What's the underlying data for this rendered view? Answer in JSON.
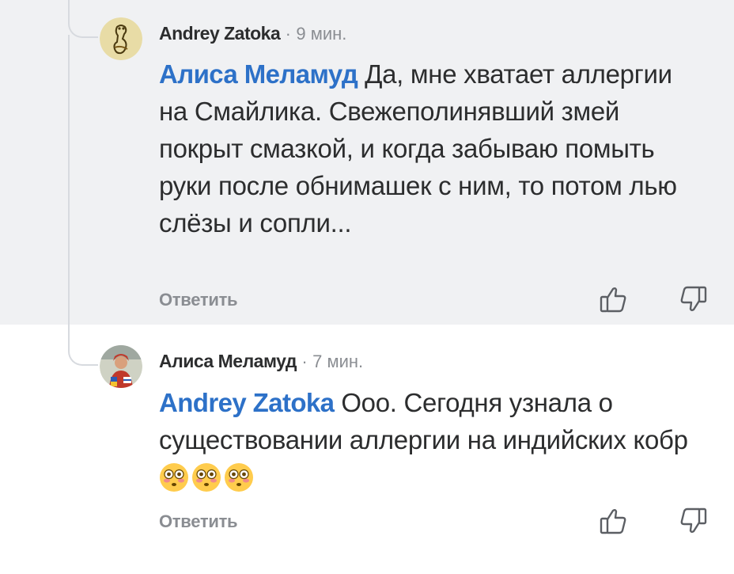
{
  "comments": [
    {
      "author": "Andrey Zatoka",
      "separator": "·",
      "time": "9 мин.",
      "mention": "Алиса Меламуд",
      "text": "Да, мне хватает аллергии на Смайлика. Свежеполинявший змей покрыт смазкой, и когда забываю помыть руки после обнимашек с ним, то потом лью слёзы и сопли...",
      "reply_label": "Ответить"
    },
    {
      "author": "Алиса Меламуд",
      "separator": "·",
      "time": "7 мин.",
      "mention": "Andrey Zatoka",
      "text": "Ооо. Сегодня узнала о существовании аллергии на индийских кобр",
      "emojis": [
        "flushed-face-emoji",
        "flushed-face-emoji",
        "flushed-face-emoji"
      ],
      "reply_label": "Ответить"
    }
  ],
  "icons": {
    "like": "thumb-up-icon",
    "dislike": "thumb-down-icon"
  },
  "colors": {
    "mention": "#2d71c8",
    "highlight_bg": "#f0f1f3",
    "muted": "#8a8d92",
    "text": "#2c2d2e"
  }
}
